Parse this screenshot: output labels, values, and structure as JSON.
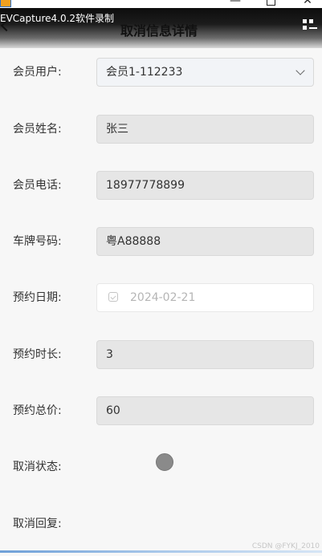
{
  "window": {
    "minimize_glyph": "—",
    "close_glyph": "✕",
    "app_icon": "evcapture-app-icon"
  },
  "nav": {
    "capture_title": "EVCapture4.0.2软件录制",
    "page_title": "取消信息详情",
    "back_icon": "chevron-left-icon",
    "menu_icon": "grid-menu-icon"
  },
  "form": {
    "member_user": {
      "label": "会员用户:",
      "value": "会员1-112233"
    },
    "member_name": {
      "label": "会员姓名:",
      "value": "张三"
    },
    "member_phone": {
      "label": "会员电话:",
      "value": "18977778899"
    },
    "plate_number": {
      "label": "车牌号码:",
      "value": "粤A88888"
    },
    "booking_date": {
      "label": "预约日期:",
      "value": "2024-02-21"
    },
    "booking_duration": {
      "label": "预约时长:",
      "value": "3"
    },
    "booking_total": {
      "label": "预约总价:",
      "value": "60"
    },
    "cancel_status": {
      "label": "取消状态:"
    },
    "cancel_reply": {
      "label": "取消回复:"
    }
  },
  "watermark": "CSDN @FYKJ_2010",
  "colors": {
    "disabled_field_bg": "#e6e6e6",
    "page_bg": "#f7f7f7",
    "status_dot": "#8a8a8a"
  }
}
